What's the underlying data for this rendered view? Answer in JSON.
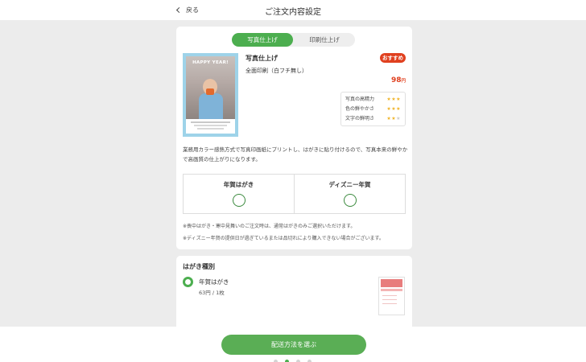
{
  "header": {
    "back_label": "戻る",
    "title": "ご注文内容設定"
  },
  "finish_tabs": {
    "active": "写真仕上げ",
    "inactive": "印刷仕上げ"
  },
  "product": {
    "thumb_text": "HAPPY YEAR!",
    "name": "写真仕上げ",
    "subtitle": "全面印刷（白フチ無し）",
    "badge": "おすすめ",
    "price": "98",
    "price_unit": "円",
    "ratings": [
      {
        "label": "写真の高精力",
        "stars": 3
      },
      {
        "label": "色の鮮やかさ",
        "stars": 3
      },
      {
        "label": "文字の鮮明さ",
        "stars": 2
      }
    ],
    "description": "業務用カラー感熱方式で写真印画紙にプリントし、はがきに貼り付けるので、写真本来の鮮やかで高画質の仕上がりになります。"
  },
  "card_options": [
    {
      "label": "年賀はがき"
    },
    {
      "label": "ディズニー年賀"
    }
  ],
  "notes": [
    "※喪中はがき・寒中見舞いのご注文時は、通常はがきのみご選択いただけます。",
    "※ディズニー年賀の提供日が過ぎているまたは品切れにより購入できない場合がございます。"
  ],
  "card_type": {
    "title": "はがき種別",
    "items": [
      {
        "name": "年賀はがき",
        "price": "63円 / 1枚"
      }
    ]
  },
  "footer": {
    "cta": "配送方法を選ぶ"
  },
  "colors": {
    "accent_green": "#4cae4f",
    "badge_red": "#e0401f",
    "star_gold": "#f0b429"
  }
}
